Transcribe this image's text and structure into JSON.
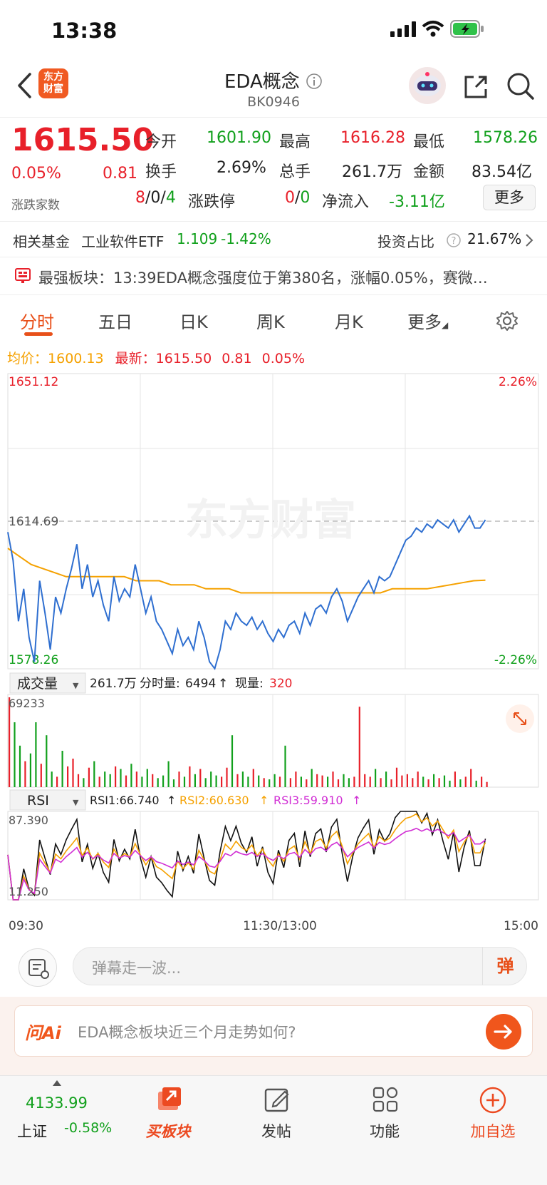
{
  "status_bar": {
    "time": "13:38"
  },
  "header": {
    "title": "EDA概念",
    "code": "BK0946",
    "logo_line1": "东方",
    "logo_line2": "财富"
  },
  "quote": {
    "price": "1615.50",
    "change_pct": "0.05%",
    "change": "0.81",
    "rows": [
      [
        {
          "label": "今开",
          "value": "1601.90"
        },
        {
          "label": "最高",
          "value": "1616.28"
        },
        {
          "label": "最低",
          "value": "1578.26"
        }
      ],
      [
        {
          "label": "换手",
          "value": "2.69%"
        },
        {
          "label": "总手",
          "value": "261.7万"
        },
        {
          "label": "金额",
          "value": "83.54亿"
        }
      ]
    ],
    "updown_label": "涨跌家数",
    "up": "8",
    "flat": "0",
    "down": "4",
    "limit_label": "涨跌停",
    "limit_up": "0",
    "limit_down": "0",
    "netflow_label": "净流入",
    "netflow": "-3.11亿",
    "more_label": "更多"
  },
  "fund": {
    "label": "相关基金",
    "name": "工业软件ETF",
    "nav": "1.109",
    "pct": "-1.42%",
    "ratio_label": "投资占比",
    "ratio": "21.67%"
  },
  "strongest": {
    "text": "最强板块：13:39EDA概念强度位于第380名，涨幅0.05%，赛微…"
  },
  "tabs": [
    "分时",
    "五日",
    "日K",
    "周K",
    "月K",
    "更多"
  ],
  "chart": {
    "avg_label": "均价：",
    "avg_value": "1600.13",
    "latest_label": "最新：",
    "latest_value": "1615.50",
    "latest_change": "0.81",
    "latest_pct": "0.05%",
    "top_price": "1651.12",
    "prev_close": "1614.69",
    "bottom_price": "1578.26",
    "top_pct": "2.26%",
    "bottom_pct": "-2.26%",
    "watermark": "东方财富",
    "vol_selector": "成交量",
    "vol_total": "261.7万",
    "vol_split_label": "分时量:",
    "vol_split": "6494",
    "vol_now_label": "现量:",
    "vol_now": "320",
    "vol_max": "69233",
    "rsi_selector": "RSI",
    "rsi1": "RSI1:66.740",
    "rsi2": "RSI2:60.630",
    "rsi3": "RSI3:59.910",
    "rsi_max": "87.390",
    "rsi_min": "11.250",
    "time_start": "09:30",
    "time_mid": "11:30/13:00",
    "time_end": "15:00"
  },
  "chart_data": {
    "type": "line",
    "ylim": [
      1578.26,
      1651.12
    ],
    "prev_close": 1614.69,
    "price_series": [
      1612,
      1605,
      1590,
      1598,
      1586,
      1580,
      1600,
      1592,
      1583,
      1596,
      1592,
      1598,
      1603,
      1609,
      1598,
      1604,
      1596,
      1600,
      1594,
      1590,
      1601,
      1595,
      1598,
      1596,
      1604,
      1598,
      1592,
      1596,
      1590,
      1588,
      1585,
      1582,
      1588,
      1584,
      1586,
      1583,
      1590,
      1586,
      1580,
      1578.3,
      1583,
      1590,
      1588,
      1592,
      1590,
      1589,
      1591,
      1588,
      1590,
      1587,
      1585,
      1588,
      1586,
      1589,
      1590,
      1587,
      1592,
      1589,
      1593,
      1594,
      1592,
      1596,
      1598,
      1595,
      1590,
      1593,
      1596,
      1598,
      1600,
      1597,
      1601,
      1600,
      1601,
      1604,
      1607,
      1610,
      1611,
      1613,
      1612,
      1614,
      1613,
      1615,
      1614,
      1613,
      1615,
      1612,
      1614,
      1616,
      1613,
      1613,
      1615
    ],
    "avg_series": [
      1608,
      1606,
      1604,
      1603,
      1602,
      1601,
      1601,
      1601,
      1601,
      1601,
      1601,
      1600,
      1600,
      1600,
      1599,
      1599,
      1599,
      1598,
      1598,
      1598,
      1597,
      1597,
      1597,
      1597,
      1597,
      1597,
      1597,
      1597,
      1597,
      1597,
      1597,
      1597,
      1597,
      1598,
      1598,
      1598,
      1598,
      1598.5,
      1599,
      1599.5,
      1600,
      1600.13
    ],
    "volume_series": [
      69233,
      50000,
      32000,
      20000,
      26000,
      50000,
      18000,
      40000,
      12000,
      8000,
      28000,
      16000,
      22000,
      10000,
      7000,
      15000,
      20000,
      8000,
      12000,
      10000,
      16000,
      14000,
      9000,
      18000,
      12000,
      8000,
      14000,
      10000,
      7000,
      9000,
      20000,
      6000,
      12000,
      8000,
      16000,
      10000,
      14000,
      7000,
      12000,
      9000,
      8000,
      15000,
      40000,
      10000,
      12000,
      8000,
      14000,
      9000,
      7000,
      6000,
      10000,
      8000,
      32000,
      7000,
      12000,
      8000,
      6000,
      14000,
      10000,
      9000,
      8000,
      12000,
      6000,
      10000,
      7000,
      8000,
      62000,
      10000,
      8000,
      14000,
      7000,
      12000,
      6000,
      15000,
      9000,
      10000,
      7000,
      12000,
      8000,
      6000,
      10000,
      7000,
      9000,
      5000,
      12000,
      6000,
      8000,
      14000,
      5000,
      8000,
      4000
    ],
    "rsi_ylim": [
      11.25,
      87.39
    ]
  },
  "danmu": {
    "placeholder": "弹幕走一波...",
    "send_label": "弹"
  },
  "ai": {
    "brand": "问Ai",
    "question": "EDA概念板块近三个月走势如何?"
  },
  "bottom_nav": {
    "index_value": "4133.99",
    "index_name": "上证",
    "index_pct": "-0.58%",
    "items": [
      "买板块",
      "发帖",
      "功能",
      "加自选"
    ]
  }
}
